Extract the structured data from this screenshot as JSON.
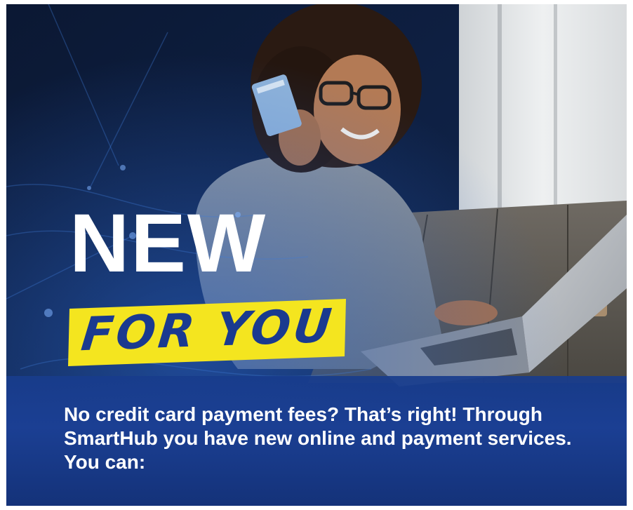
{
  "headline": {
    "line1": "NEW",
    "line2": "FOR YOU"
  },
  "body": {
    "text": "No credit card payment fees? That’s right! Through SmartHub you have new online and payment services. You can:"
  },
  "colors": {
    "navy_background": "#0d1e3d",
    "brand_blue": "#1b3f93",
    "highlight_yellow": "#f4e51f",
    "headline_white": "#ffffff",
    "script_blue": "#1a3a8f"
  }
}
